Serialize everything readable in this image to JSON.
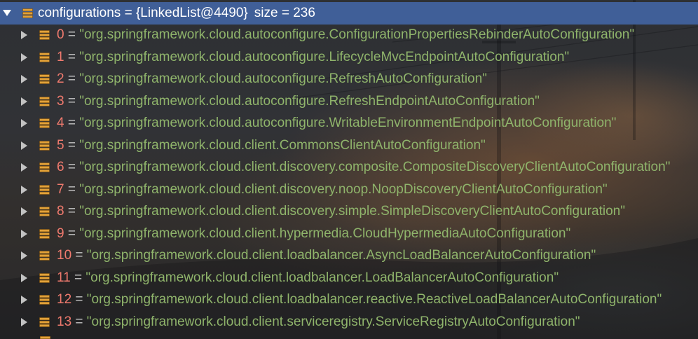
{
  "variables_panel": {
    "separator": " = ",
    "root": {
      "name": "configurations",
      "type_ref": "{LinkedList@4490}",
      "size_text": "size = 236",
      "expanded": true,
      "selected": true,
      "icon": "list-icon",
      "toggle_icon": "chevron-down-icon"
    },
    "child_icon": "list-icon",
    "child_toggle_icon": "chevron-right-icon",
    "children": [
      {
        "index": "0",
        "value": "\"org.springframework.cloud.autoconfigure.ConfigurationPropertiesRebinderAutoConfiguration\""
      },
      {
        "index": "1",
        "value": "\"org.springframework.cloud.autoconfigure.LifecycleMvcEndpointAutoConfiguration\""
      },
      {
        "index": "2",
        "value": "\"org.springframework.cloud.autoconfigure.RefreshAutoConfiguration\""
      },
      {
        "index": "3",
        "value": "\"org.springframework.cloud.autoconfigure.RefreshEndpointAutoConfiguration\""
      },
      {
        "index": "4",
        "value": "\"org.springframework.cloud.autoconfigure.WritableEnvironmentEndpointAutoConfiguration\""
      },
      {
        "index": "5",
        "value": "\"org.springframework.cloud.client.CommonsClientAutoConfiguration\""
      },
      {
        "index": "6",
        "value": "\"org.springframework.cloud.client.discovery.composite.CompositeDiscoveryClientAutoConfiguration\""
      },
      {
        "index": "7",
        "value": "\"org.springframework.cloud.client.discovery.noop.NoopDiscoveryClientAutoConfiguration\""
      },
      {
        "index": "8",
        "value": "\"org.springframework.cloud.client.discovery.simple.SimpleDiscoveryClientAutoConfiguration\""
      },
      {
        "index": "9",
        "value": "\"org.springframework.cloud.client.hypermedia.CloudHypermediaAutoConfiguration\""
      },
      {
        "index": "10",
        "value": "\"org.springframework.cloud.client.loadbalancer.AsyncLoadBalancerAutoConfiguration\""
      },
      {
        "index": "11",
        "value": "\"org.springframework.cloud.client.loadbalancer.LoadBalancerAutoConfiguration\""
      },
      {
        "index": "12",
        "value": "\"org.springframework.cloud.client.loadbalancer.reactive.ReactiveLoadBalancerAutoConfiguration\""
      },
      {
        "index": "13",
        "value": "\"org.springframework.cloud.client.serviceregistry.ServiceRegistryAutoConfiguration\""
      }
    ]
  },
  "colors": {
    "selection_bg": "#405f98",
    "selected_text": "#ffffff",
    "index_text": "#f07a6e",
    "operator_text": "#c5c5c5",
    "string_value": "#8fb46b",
    "list_icon": "#e2a23a",
    "tree_arrow": "#c2c2c2"
  }
}
